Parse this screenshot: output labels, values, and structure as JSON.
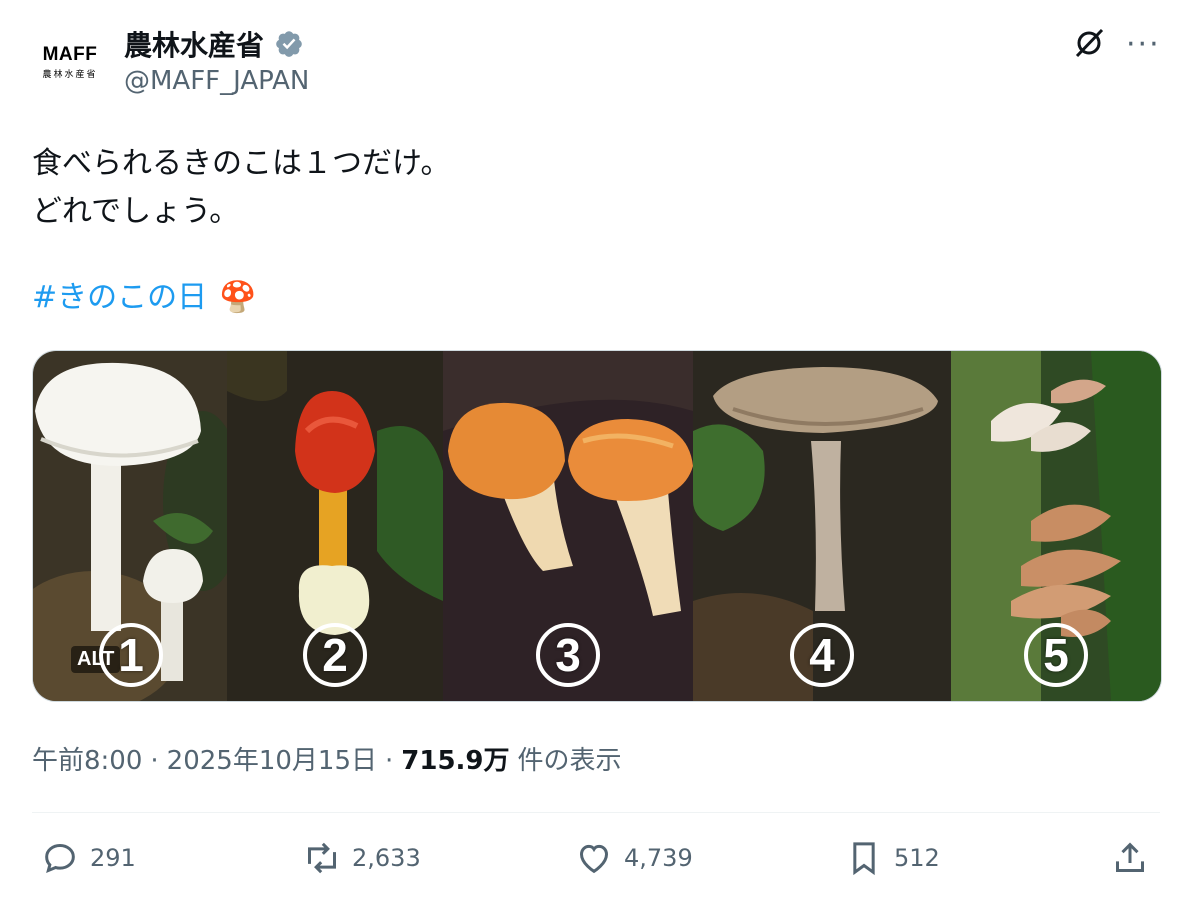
{
  "author": {
    "logo_text": "MAFF",
    "logo_subtext": "農林水産省",
    "name": "農林水産省",
    "handle": "@MAFF_JAPAN"
  },
  "tweet": {
    "line1": "食べられるきのこは１つだけ。",
    "line2": "どれでしょう。",
    "hashtag": "#きのこの日",
    "emoji": "🍄"
  },
  "media": {
    "alt_label": "ALT",
    "panels": [
      {
        "number": "1"
      },
      {
        "number": "2"
      },
      {
        "number": "3"
      },
      {
        "number": "4"
      },
      {
        "number": "5"
      }
    ]
  },
  "meta": {
    "time": "午前8:00",
    "separator": "·",
    "date": "2025年10月15日",
    "views_count": "715.9万",
    "views_label": "件の表示"
  },
  "actions": {
    "replies": "291",
    "reposts": "2,633",
    "likes": "4,739",
    "bookmarks": "512"
  },
  "colors": {
    "accent": "#1d9bf0",
    "secondary_text": "#536471",
    "verified_badge": "#829aab"
  },
  "icons": [
    "verified-badge-icon",
    "grok-icon",
    "more-icon",
    "reply-icon",
    "repost-icon",
    "like-icon",
    "bookmark-icon",
    "share-icon"
  ]
}
